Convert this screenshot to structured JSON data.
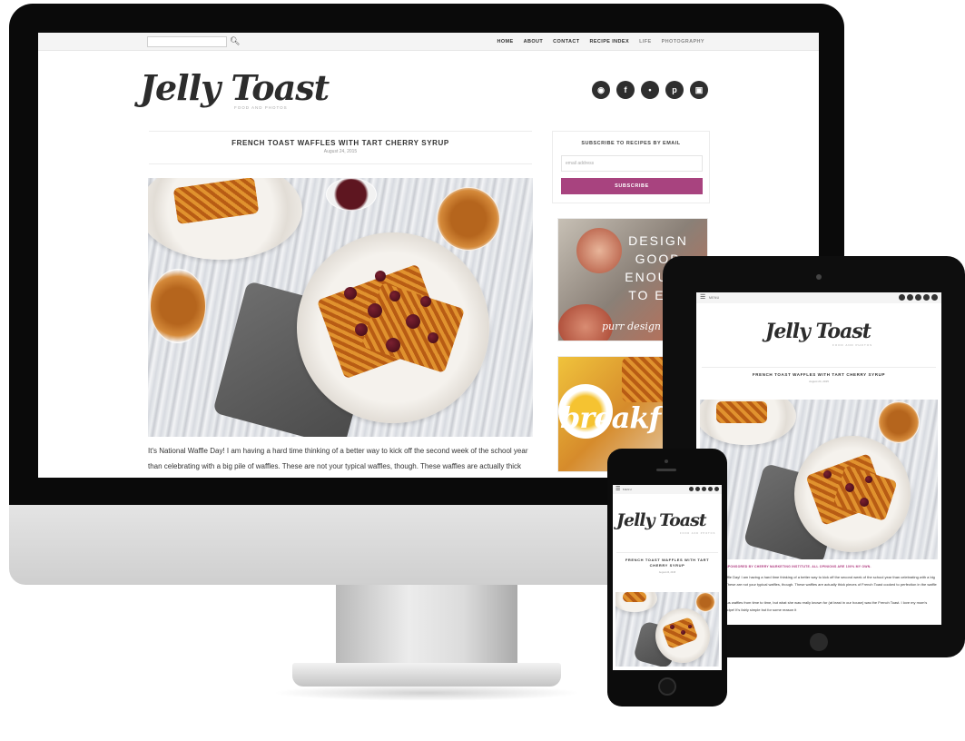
{
  "desktop": {
    "search": {
      "placeholder": ""
    },
    "nav": [
      "HOME",
      "ABOUT",
      "CONTACT",
      "RECIPE INDEX",
      "LIFE",
      "PHOTOGRAPHY"
    ],
    "logo": "Jelly Toast",
    "tagline": "FOOD AND PHOTOS",
    "social_icons": [
      "rss-icon",
      "facebook-icon",
      "twitter-icon",
      "pinterest-icon",
      "instagram-icon"
    ],
    "post": {
      "title": "FRENCH TOAST WAFFLES WITH TART CHERRY SYRUP",
      "date": "August 24, 2015",
      "body": "It's National Waffle Day! I am having a hard time thinking of a better way to kick off the second week of the school year than celebrating with a big pile of waffles. These are not your typical waffles, though. These waffles are actually thick pieces of French Toast cooked to perfection in the waffle iron."
    },
    "sidebar": {
      "subscribe_title": "SUBSCRIBE TO RECIPES BY EMAIL",
      "email_placeholder": "email address",
      "subscribe_button": "SUBSCRIBE",
      "ad1_lines": [
        "DESIGN",
        "GOOD",
        "ENOUGH",
        "TO EAT."
      ],
      "ad1_script": "purr design",
      "ad2_word": "breakf"
    }
  },
  "tablet": {
    "menu_label": "MENU",
    "logo": "Jelly Toast",
    "tagline": "FOOD AND PHOTOS",
    "post_title": "FRENCH TOAST WAFFLES WITH TART CHERRY SYRUP",
    "date": "August 24, 2015",
    "sponsor": "THIS POST IS SPONSORED BY CHERRY MARKETING INSTITUTE. ALL OPINIONS ARE 100% MY OWN.",
    "body1": "It's National Waffle Day! I am having a hard time thinking of a better way to kick off the second week of the school year than celebrating with a big pile of waffles. These are not your typical waffles, though. These waffles are actually thick pieces of French Toast cooked to perfection in the waffle iron.",
    "body2": "My mom made us waffles from time to time, but what she was really known for (at least in our house) was the French Toast. I love my mom's French Toast recipe! It's fairly simple but for some reason it"
  },
  "phone": {
    "menu_label": "MENU",
    "logo": "Jelly Toast",
    "tagline": "FOOD AND PHOTOS",
    "post_title": "FRENCH TOAST WAFFLES WITH TART CHERRY SYRUP",
    "date": "August 24, 2015"
  },
  "colors": {
    "accent": "#a8437f",
    "sponsor": "#b03c80",
    "text": "#333333"
  }
}
